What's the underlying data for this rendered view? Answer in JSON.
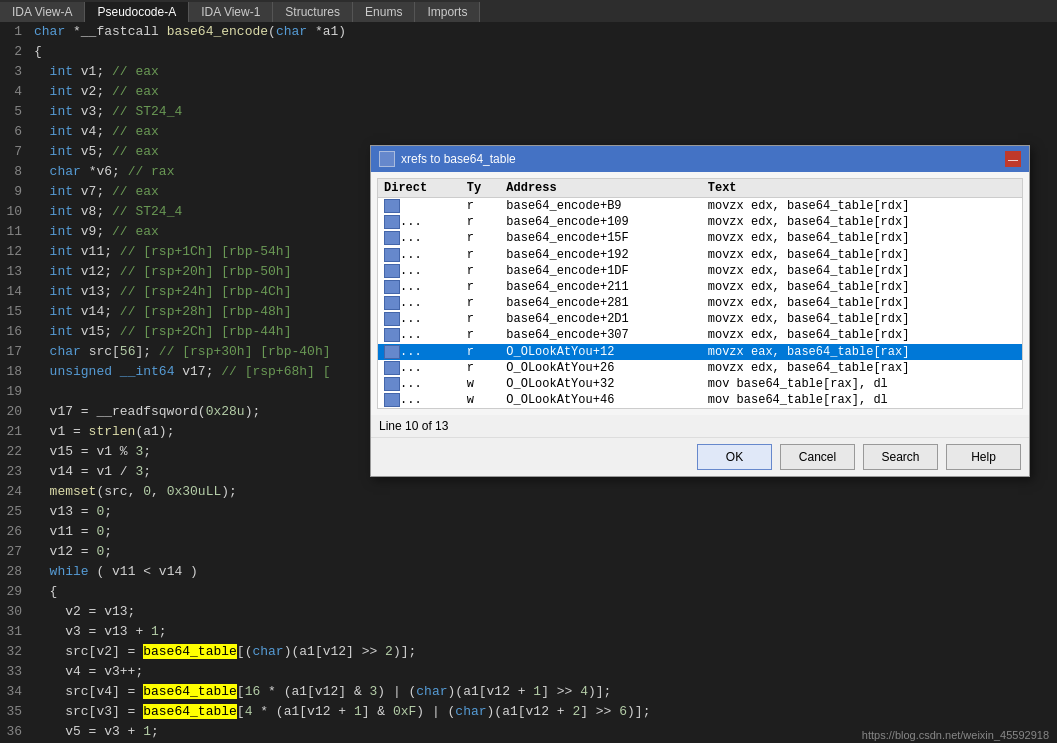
{
  "tabs": [
    {
      "label": "IDA View-A",
      "active": false
    },
    {
      "label": "Pseudocode-A",
      "active": true
    },
    {
      "label": "IDA View-1",
      "active": false
    },
    {
      "label": "Structures",
      "active": false
    },
    {
      "label": "Enums",
      "active": false
    },
    {
      "label": "Imports",
      "active": false
    }
  ],
  "code_lines": [
    {
      "num": "1",
      "text": "char *__fastcall base64_encode(char *a1)"
    },
    {
      "num": "2",
      "text": "{"
    },
    {
      "num": "3",
      "text": "  int v1; // eax"
    },
    {
      "num": "4",
      "text": "  int v2; // eax"
    },
    {
      "num": "5",
      "text": "  int v3; // ST24_4"
    },
    {
      "num": "6",
      "text": "  int v4; // eax"
    },
    {
      "num": "7",
      "text": "  int v5; // eax"
    },
    {
      "num": "8",
      "text": "  char *v6; // rax"
    },
    {
      "num": "9",
      "text": "  int v7; // eax"
    },
    {
      "num": "10",
      "text": "  int v8; // ST24_4"
    },
    {
      "num": "11",
      "text": "  int v9; // eax"
    },
    {
      "num": "12",
      "text": "  int v11; // [rsp+1Ch] [rbp-54h]"
    },
    {
      "num": "13",
      "text": "  int v12; // [rsp+20h] [rbp-50h]"
    },
    {
      "num": "14",
      "text": "  int v13; // [rsp+24h] [rbp-4Ch]"
    },
    {
      "num": "15",
      "text": "  int v14; // [rsp+28h] [rbp-48h]"
    },
    {
      "num": "16",
      "text": "  int v15; // [rsp+2Ch] [rbp-44h]"
    },
    {
      "num": "17",
      "text": "  char src[56]; // [rsp+30h] [rbp-40h]"
    },
    {
      "num": "18",
      "text": "  unsigned __int64 v17; // [rsp+68h] ["
    },
    {
      "num": "19",
      "text": ""
    },
    {
      "num": "20",
      "text": "  v17 = __readfsqword(0x28u);"
    },
    {
      "num": "21",
      "text": "  v1 = strlen(a1);"
    },
    {
      "num": "22",
      "text": "  v15 = v1 % 3;"
    },
    {
      "num": "23",
      "text": "  v14 = v1 / 3;"
    },
    {
      "num": "24",
      "text": "  memset(src, 0, 0x30uLL);"
    },
    {
      "num": "25",
      "text": "  v13 = 0;"
    },
    {
      "num": "26",
      "text": "  v11 = 0;"
    },
    {
      "num": "27",
      "text": "  v12 = 0;"
    },
    {
      "num": "28",
      "text": "  while ( v11 < v14 )"
    },
    {
      "num": "29",
      "text": "  {"
    },
    {
      "num": "30",
      "text": "    v2 = v13;"
    },
    {
      "num": "31",
      "text": "    v3 = v13 + 1;"
    },
    {
      "num": "32",
      "text": "    src[v2] = base64_table[(char)(a1[v12] >> 2)];"
    },
    {
      "num": "33",
      "text": "    v4 = v3++;"
    },
    {
      "num": "34",
      "text": "    src[v4] = base64_table[16 * (a1[v12] & 3) | (char)(a1[v12 + 1] >> 4)];"
    },
    {
      "num": "35",
      "text": "    src[v3] = base64_table[4 * (a1[v12 + 1] & 0xF) | (char)(a1[v12 + 2] >> 6)];"
    },
    {
      "num": "36",
      "text": "    v5 = v3 + 1;"
    }
  ],
  "dialog": {
    "title": "xrefs to base64_table",
    "columns": [
      "Direct",
      "Ty",
      "Address",
      "Text"
    ],
    "rows": [
      {
        "icon": true,
        "dots": "",
        "direct": "r",
        "address": "base64_encode+B9",
        "text": "movzx   edx, base64_table[rdx]",
        "selected": false
      },
      {
        "icon": true,
        "dots": "...",
        "direct": "r",
        "address": "base64_encode+109",
        "text": "movzx   edx, base64_table[rdx]",
        "selected": false
      },
      {
        "icon": true,
        "dots": "...",
        "direct": "r",
        "address": "base64_encode+15F",
        "text": "movzx   edx, base64_table[rdx]",
        "selected": false
      },
      {
        "icon": true,
        "dots": "...",
        "direct": "r",
        "address": "base64_encode+192",
        "text": "movzx   edx, base64_table[rdx]",
        "selected": false
      },
      {
        "icon": true,
        "dots": "...",
        "direct": "r",
        "address": "base64_encode+1DF",
        "text": "movzx   edx, base64_table[rdx]",
        "selected": false
      },
      {
        "icon": true,
        "dots": "...",
        "direct": "r",
        "address": "base64_encode+211",
        "text": "movzx   edx, base64_table[rdx]",
        "selected": false
      },
      {
        "icon": true,
        "dots": "...",
        "direct": "r",
        "address": "base64_encode+281",
        "text": "movzx   edx, base64_table[rdx]",
        "selected": false
      },
      {
        "icon": true,
        "dots": "...",
        "direct": "r",
        "address": "base64_encode+2D1",
        "text": "movzx   edx, base64_table[rdx]",
        "selected": false
      },
      {
        "icon": true,
        "dots": "...",
        "direct": "r",
        "address": "base64_encode+307",
        "text": "movzx   edx, base64_table[rdx]",
        "selected": false
      },
      {
        "icon": true,
        "dots": "...",
        "direct": "r",
        "address": "O_OLookAtYou+12",
        "text": "movzx   eax, base64_table[rax]",
        "selected": true
      },
      {
        "icon": true,
        "dots": "...",
        "direct": "r",
        "address": "O_OLookAtYou+26",
        "text": "movzx   edx, base64_table[rax]",
        "selected": false
      },
      {
        "icon": true,
        "dots": "...",
        "direct": "w",
        "address": "O_OLookAtYou+32",
        "text": "mov     base64_table[rax], dl",
        "selected": false
      },
      {
        "icon": true,
        "dots": "...",
        "direct": "w",
        "address": "O_OLookAtYou+46",
        "text": "mov     base64_table[rax], dl",
        "selected": false
      }
    ],
    "status": "Line 10 of 13",
    "buttons": [
      "OK",
      "Cancel",
      "Search",
      "Help"
    ]
  },
  "watermark": "https://blog.csdn.net/weixin_45592918"
}
